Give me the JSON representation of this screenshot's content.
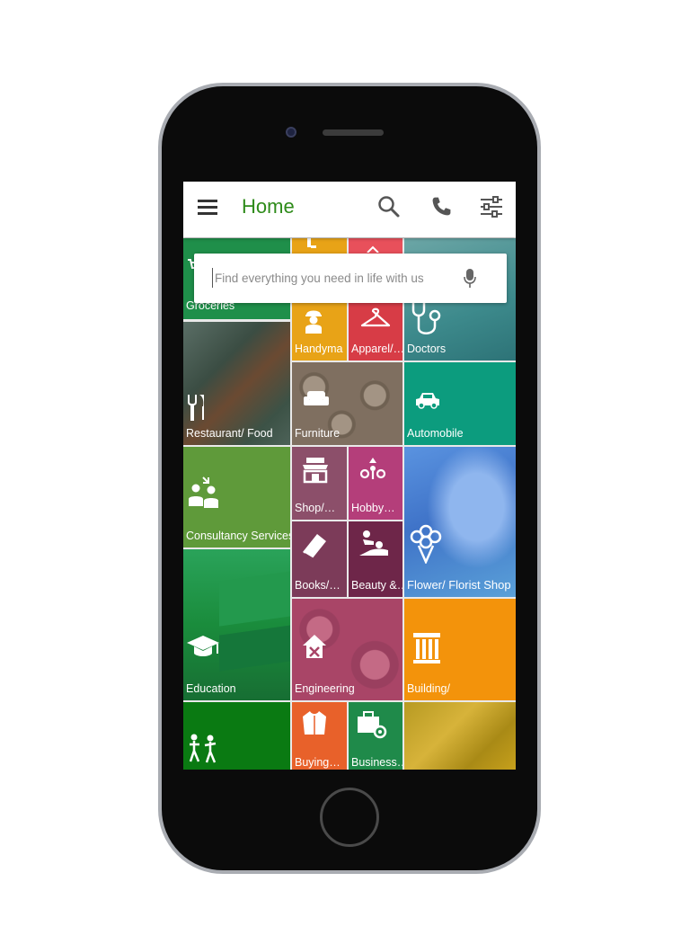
{
  "appbar": {
    "title": "Home",
    "menu_icon": "hamburger-menu-icon",
    "search_icon": "search-icon",
    "call_icon": "phone-icon",
    "filter_icon": "filter-sliders-icon"
  },
  "search": {
    "placeholder": "Find everything you need in life with us",
    "mic_icon": "microphone-icon"
  },
  "tiles": [
    {
      "label": "Groceries",
      "icon": "cart-icon",
      "color": "#1f8f4a"
    },
    {
      "label": "",
      "icon": "tools-icon",
      "color": "#e8a317"
    },
    {
      "label": "",
      "icon": "tag-icon",
      "color": "#e8505b"
    },
    {
      "label": "Handyma",
      "icon": "handyman-icon",
      "color": "#e8a317"
    },
    {
      "label": "Apparel/…",
      "icon": "hanger-icon",
      "color": "#d73c46"
    },
    {
      "label": "Doctors",
      "icon": "stethoscope-icon",
      "color": "#3f8b8e"
    },
    {
      "label": "Restaurant/ Food",
      "icon": "fork-knife-icon",
      "color": "#3f5a4e"
    },
    {
      "label": "Furniture",
      "icon": "sofa-icon",
      "color": "#7a6a5c"
    },
    {
      "label": "Automobile",
      "icon": "car-icon",
      "color": "#0c9c7e"
    },
    {
      "label": "Consultancy Services",
      "icon": "consultancy-people-icon",
      "color": "#5f9a3a"
    },
    {
      "label": "Shop/…",
      "icon": "shop-icon",
      "color": "#8c4f6a"
    },
    {
      "label": "Hobby…",
      "icon": "hobby-icon",
      "color": "#b43e7a"
    },
    {
      "label": "Flower/ Florist Shop",
      "icon": "flower-bouquet-icon",
      "color": "#4a86d6"
    },
    {
      "label": "Books/…",
      "icon": "book-icon",
      "color": "#7c3b59"
    },
    {
      "label": "Beauty &…",
      "icon": "spa-massage-icon",
      "color": "#6e2649"
    },
    {
      "label": "Education",
      "icon": "graduation-cap-icon",
      "color": "#1a8c3c"
    },
    {
      "label": "Engineering",
      "icon": "engineering-house-icon",
      "color": "#a94567"
    },
    {
      "label": "Building/",
      "icon": "building-columns-icon",
      "color": "#f3930b"
    },
    {
      "label": "",
      "icon": "kids-play-icon",
      "color": "#0a7a12"
    },
    {
      "label": "Buying…",
      "icon": "jacket-icon",
      "color": "#e8612a"
    },
    {
      "label": "Business…",
      "icon": "briefcase-gear-icon",
      "color": "#1f8a4a"
    },
    {
      "label": "",
      "icon": "",
      "color": "#c9a21c"
    }
  ]
}
